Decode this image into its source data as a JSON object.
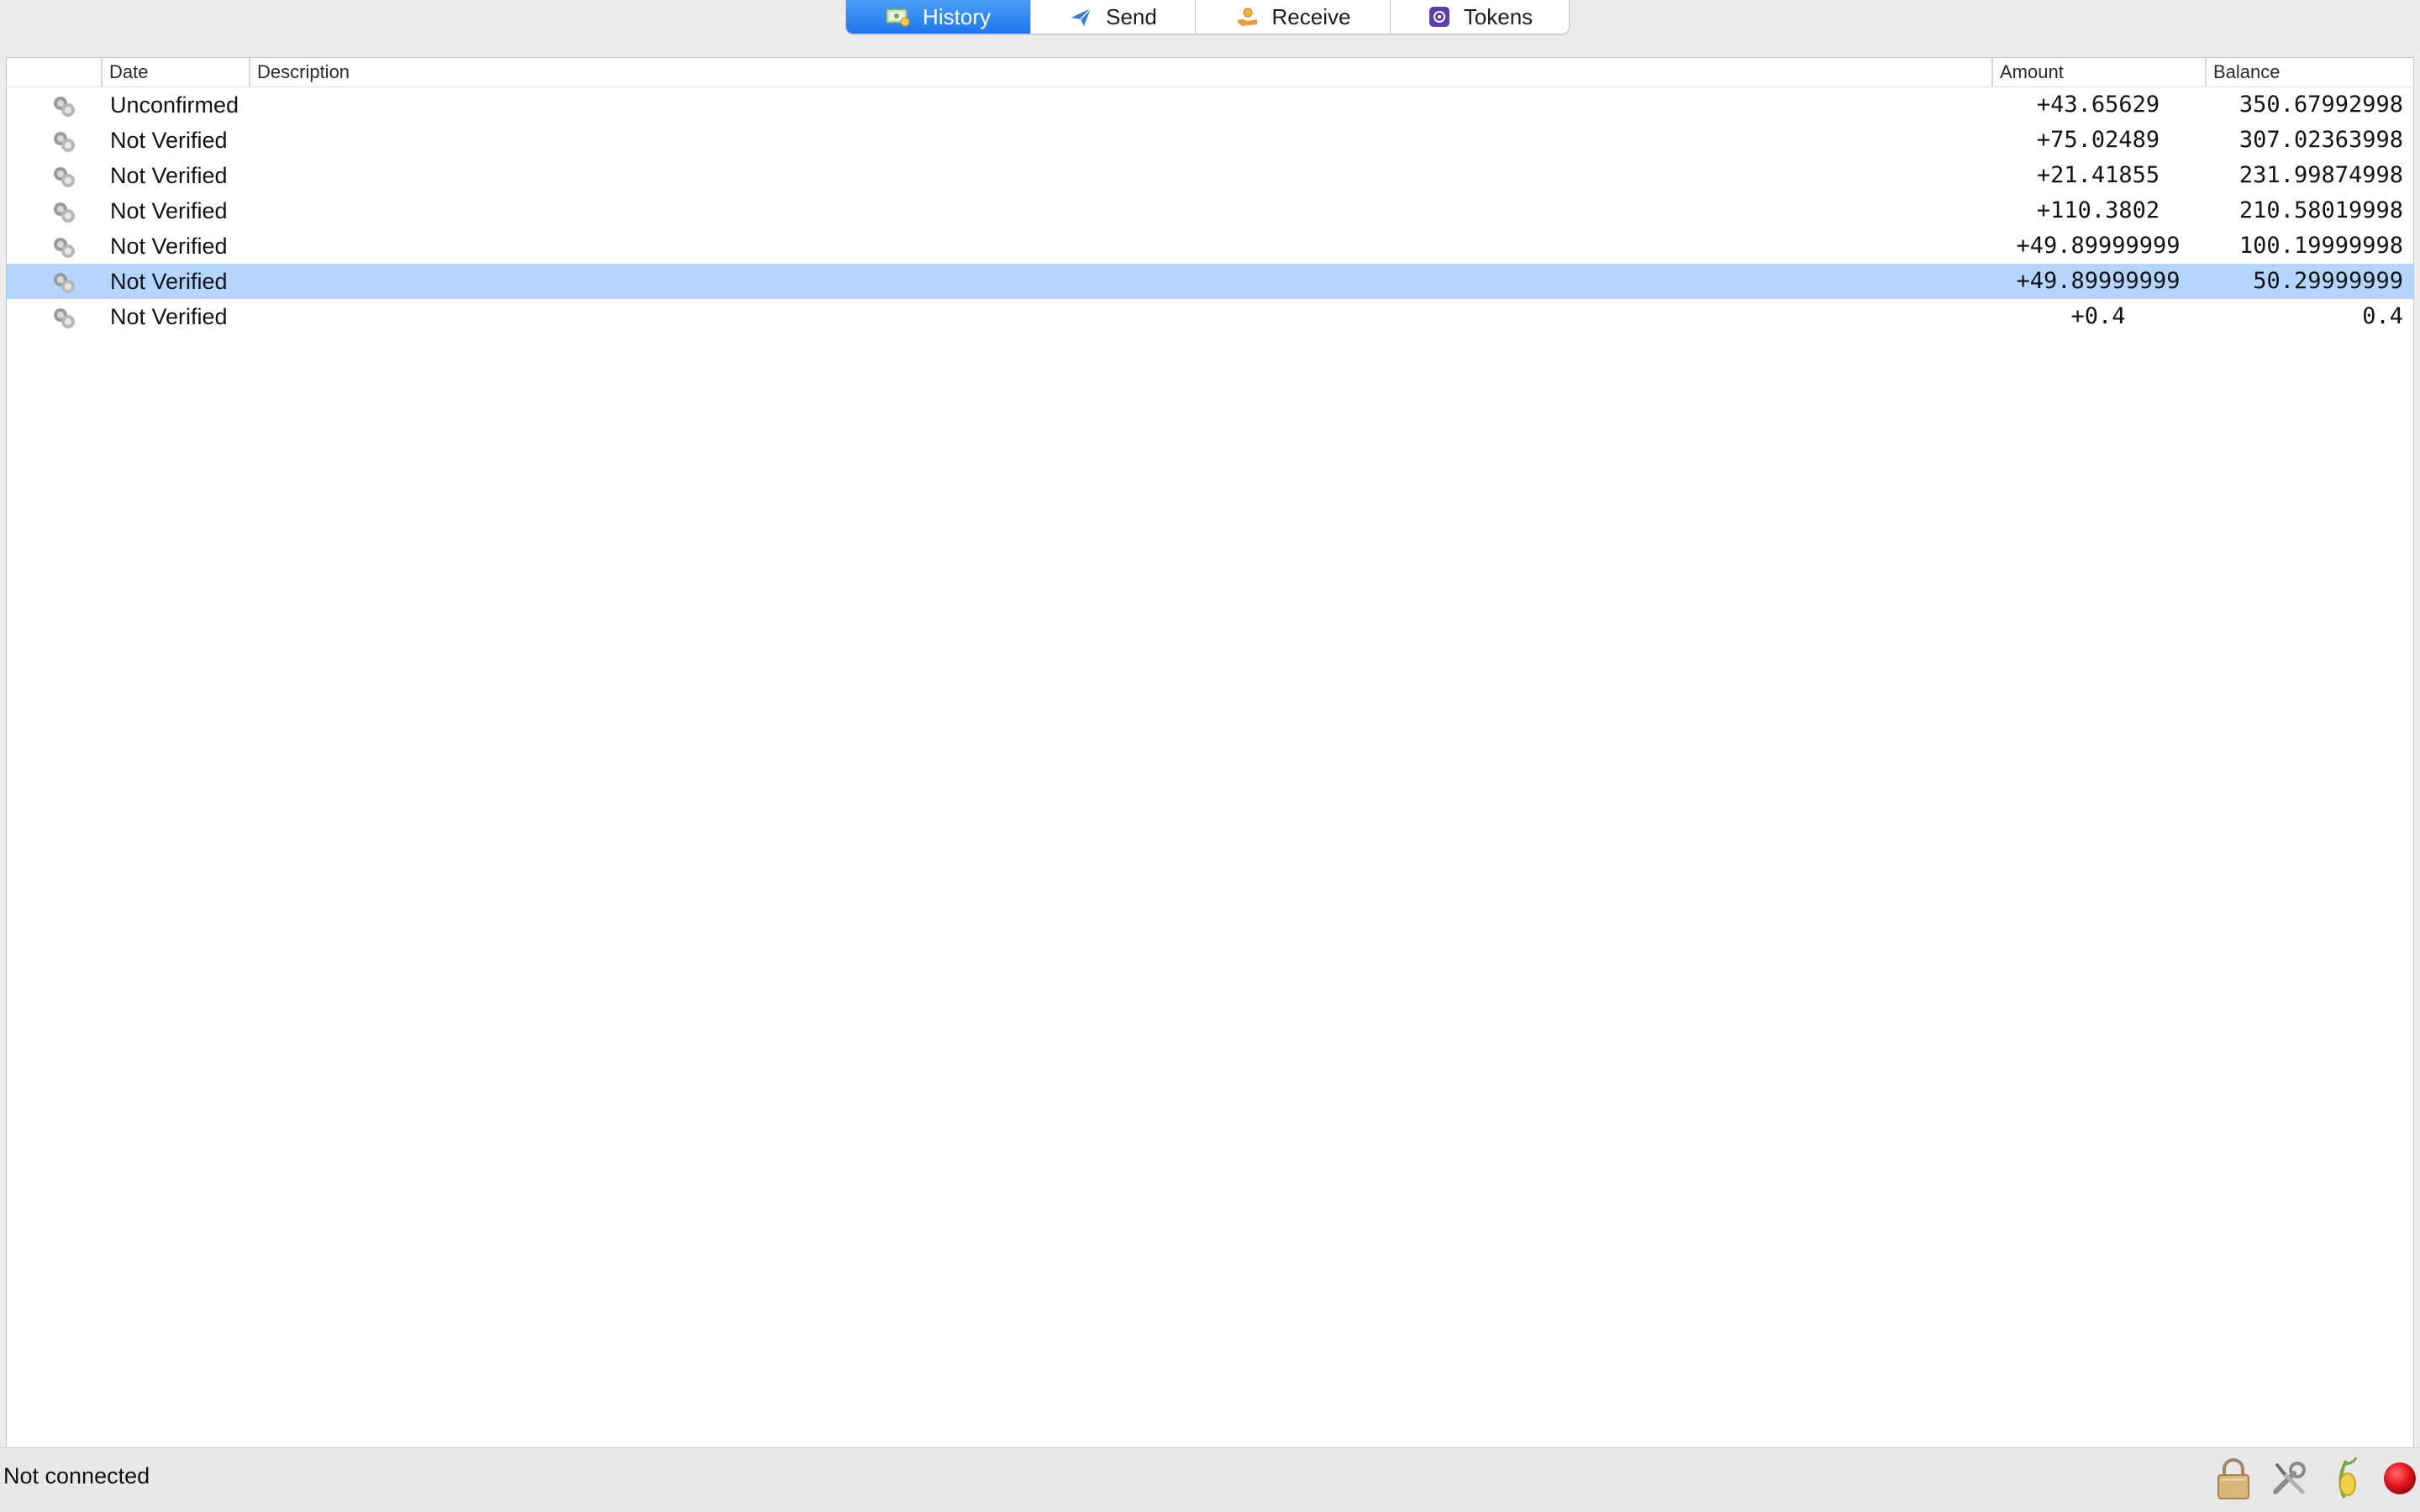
{
  "tabs": [
    {
      "label": "History",
      "icon": "history-icon",
      "active": true
    },
    {
      "label": "Send",
      "icon": "send-icon",
      "active": false
    },
    {
      "label": "Receive",
      "icon": "receive-icon",
      "active": false
    },
    {
      "label": "Tokens",
      "icon": "tokens-icon",
      "active": false
    }
  ],
  "table": {
    "columns": {
      "status": "",
      "date": "Date",
      "description": "Description",
      "amount": "Amount",
      "balance": "Balance"
    },
    "rows": [
      {
        "icon": "transaction-status-icon",
        "date": "Unconfirmed",
        "description": "",
        "amount": "+43.65629",
        "balance": "350.67992998",
        "selected": false
      },
      {
        "icon": "transaction-status-icon",
        "date": "Not Verified",
        "description": "",
        "amount": "+75.02489",
        "balance": "307.02363998",
        "selected": false
      },
      {
        "icon": "transaction-status-icon",
        "date": "Not Verified",
        "description": "",
        "amount": "+21.41855",
        "balance": "231.99874998",
        "selected": false
      },
      {
        "icon": "transaction-status-icon",
        "date": "Not Verified",
        "description": "",
        "amount": "+110.3802",
        "balance": "210.58019998",
        "selected": false
      },
      {
        "icon": "transaction-status-icon",
        "date": "Not Verified",
        "description": "",
        "amount": "+49.89999999",
        "balance": "100.19999998",
        "selected": false
      },
      {
        "icon": "transaction-status-icon",
        "date": "Not Verified",
        "description": "",
        "amount": "+49.89999999",
        "balance": "50.29999999",
        "selected": true
      },
      {
        "icon": "transaction-status-icon",
        "date": "Not Verified",
        "description": "",
        "amount": "+0.4",
        "balance": "0.4",
        "selected": false
      }
    ]
  },
  "status": {
    "text": "Not connected",
    "icons": [
      "lock-icon",
      "tools-icon",
      "seed-icon",
      "network-status-icon"
    ],
    "network_status_color": "#e0161b"
  },
  "colors": {
    "active_tab": "#2d86f3",
    "selected_row": "#b4d5fd"
  }
}
